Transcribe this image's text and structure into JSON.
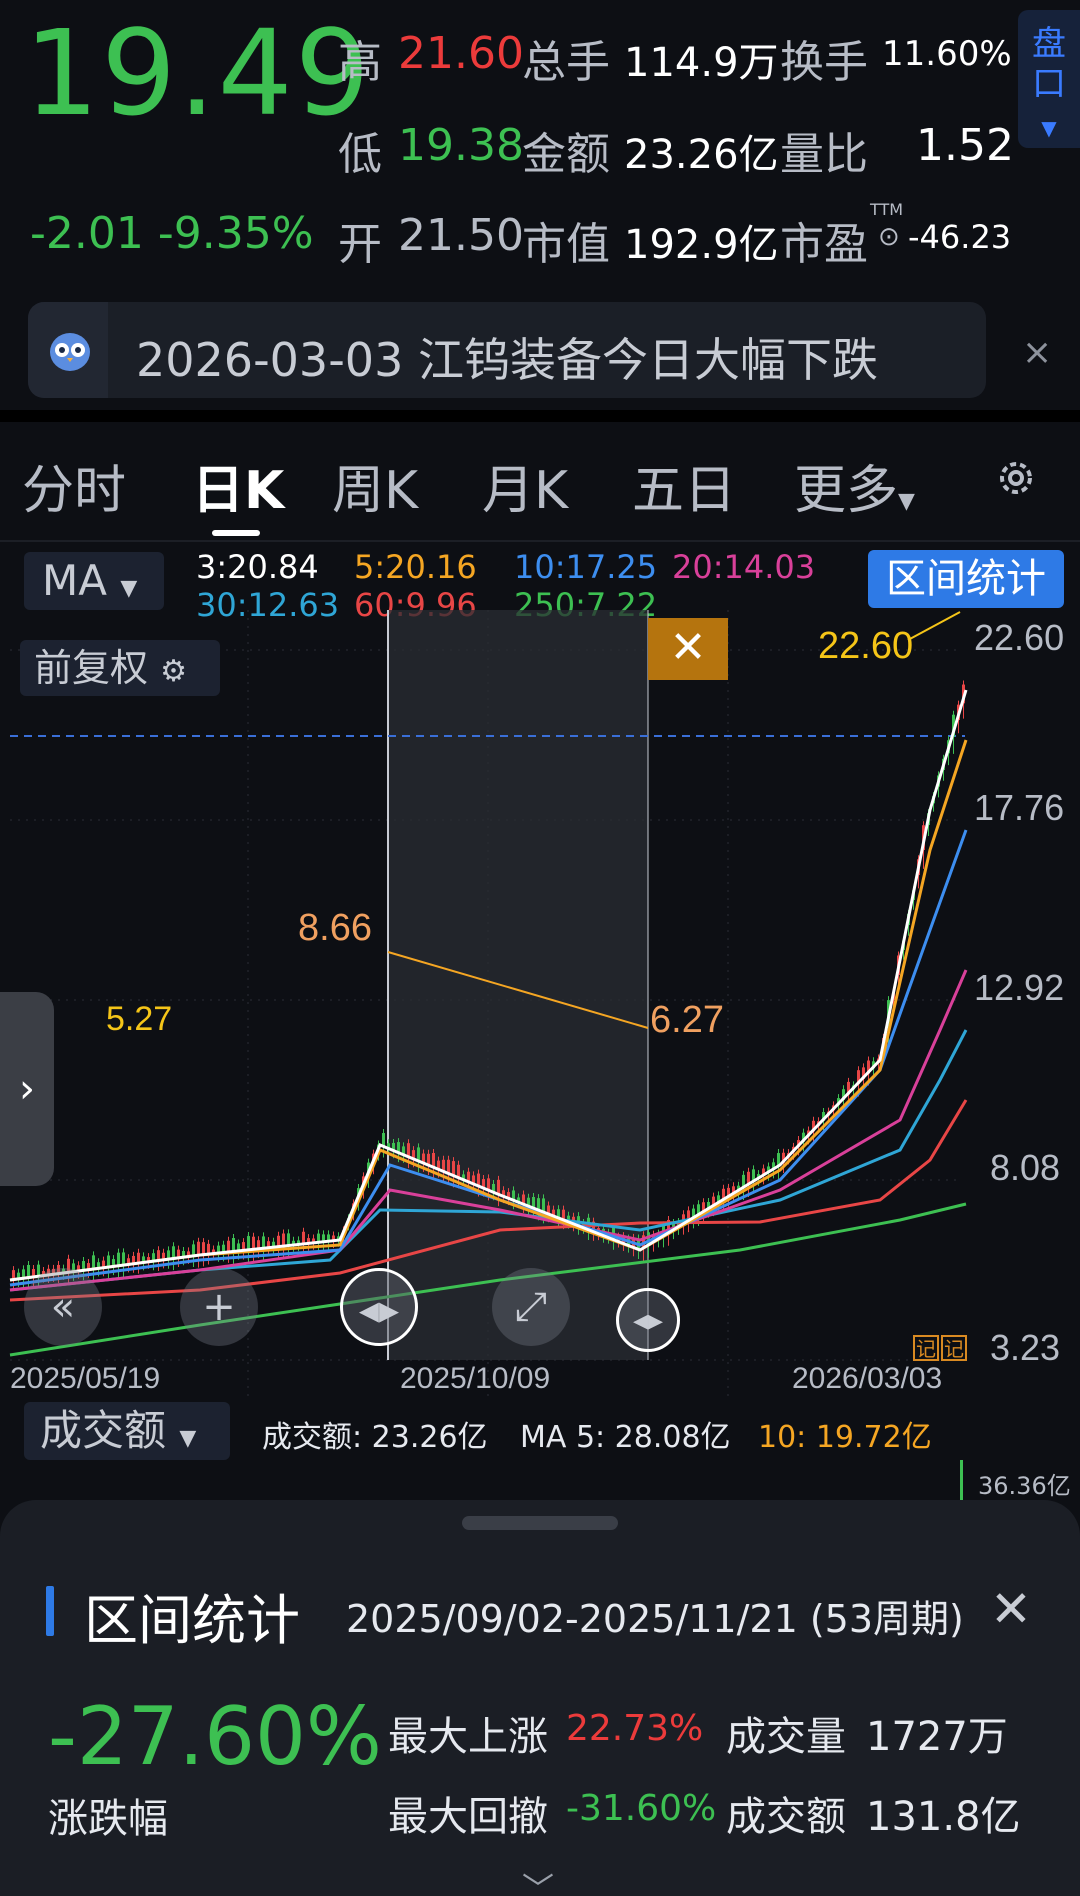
{
  "quote": {
    "price": "19.49",
    "change": "-2.01",
    "change_pct": "-9.35%",
    "high_label": "高",
    "high": "21.60",
    "low_label": "低",
    "low": "19.38",
    "open_label": "开",
    "open": "21.50",
    "volume_label": "总手",
    "volume": "114.9万",
    "amount_label": "金额",
    "amount": "23.26亿",
    "mktcap_label": "市值",
    "mktcap": "192.9亿",
    "turnover_label": "换手",
    "turnover": "11.60%",
    "volratio_label": "量比",
    "volratio": "1.52",
    "pe_label": "市盈",
    "pe_tag": "TTM",
    "pe": "-46.23",
    "pankou_label": "盘口"
  },
  "news": {
    "text": "2026-03-03 江钨装备今日大幅下跌",
    "close_glyph": "×"
  },
  "tabs": [
    {
      "label": "分时",
      "active": false
    },
    {
      "label": "日K",
      "active": true
    },
    {
      "label": "周K",
      "active": false
    },
    {
      "label": "月K",
      "active": false
    },
    {
      "label": "五日",
      "active": false
    },
    {
      "label": "更多",
      "active": false
    }
  ],
  "ma": {
    "selector": "MA",
    "values": [
      {
        "label": "3:20.84",
        "color": "#ffffff"
      },
      {
        "label": "5:20.16",
        "color": "#f5a623"
      },
      {
        "label": "10:17.25",
        "color": "#3d8ef0"
      },
      {
        "label": "20:14.03",
        "color": "#d9409a"
      },
      {
        "label": "30:12.63",
        "color": "#2fa6d6"
      },
      {
        "label": "60:9.96",
        "color": "#e84646"
      },
      {
        "label": "250:7.22",
        "color": "#3dc052"
      }
    ],
    "stat_button": "区间统计"
  },
  "chart": {
    "adjust_label": "前复权",
    "y_ticks": [
      "22.60",
      "17.76",
      "12.92",
      "8.08",
      "3.23"
    ],
    "x_ticks": [
      "2025/05/19",
      "2025/10/09",
      "2026/03/03"
    ],
    "annotations": {
      "high": "22.60",
      "peak": "8.66",
      "trough": "6.27",
      "low": "5.27"
    },
    "note_badge": "记"
  },
  "chart_data": {
    "type": "line",
    "x": [
      "2025/05/19",
      "2025/10/09",
      "2026/03/03"
    ],
    "ylim": [
      3.23,
      22.6
    ],
    "series": [
      {
        "name": "250",
        "color": "#3dc052",
        "values": [
          3.23,
          5.4,
          7.22
        ]
      },
      {
        "name": "60",
        "color": "#e84646",
        "values": [
          5.4,
          7.4,
          9.96
        ]
      }
    ]
  },
  "volume": {
    "selector": "成交额",
    "amount_text": "成交额: 23.26亿",
    "ma5_text": "MA 5: 28.08亿",
    "ma10_text": "10: 19.72亿",
    "max_label": "36.36亿"
  },
  "stat": {
    "title": "区间统计",
    "range": "2025/09/02-2025/11/21 (53周期)",
    "change_pct": "-27.60%",
    "change_label": "涨跌幅",
    "max_rise_label": "最大上涨",
    "max_rise": "22.73%",
    "max_draw_label": "最大回撤",
    "max_draw": "-31.60%",
    "vol_label": "成交量",
    "vol": "1727万",
    "amt_label": "成交额",
    "amt": "131.8亿"
  }
}
